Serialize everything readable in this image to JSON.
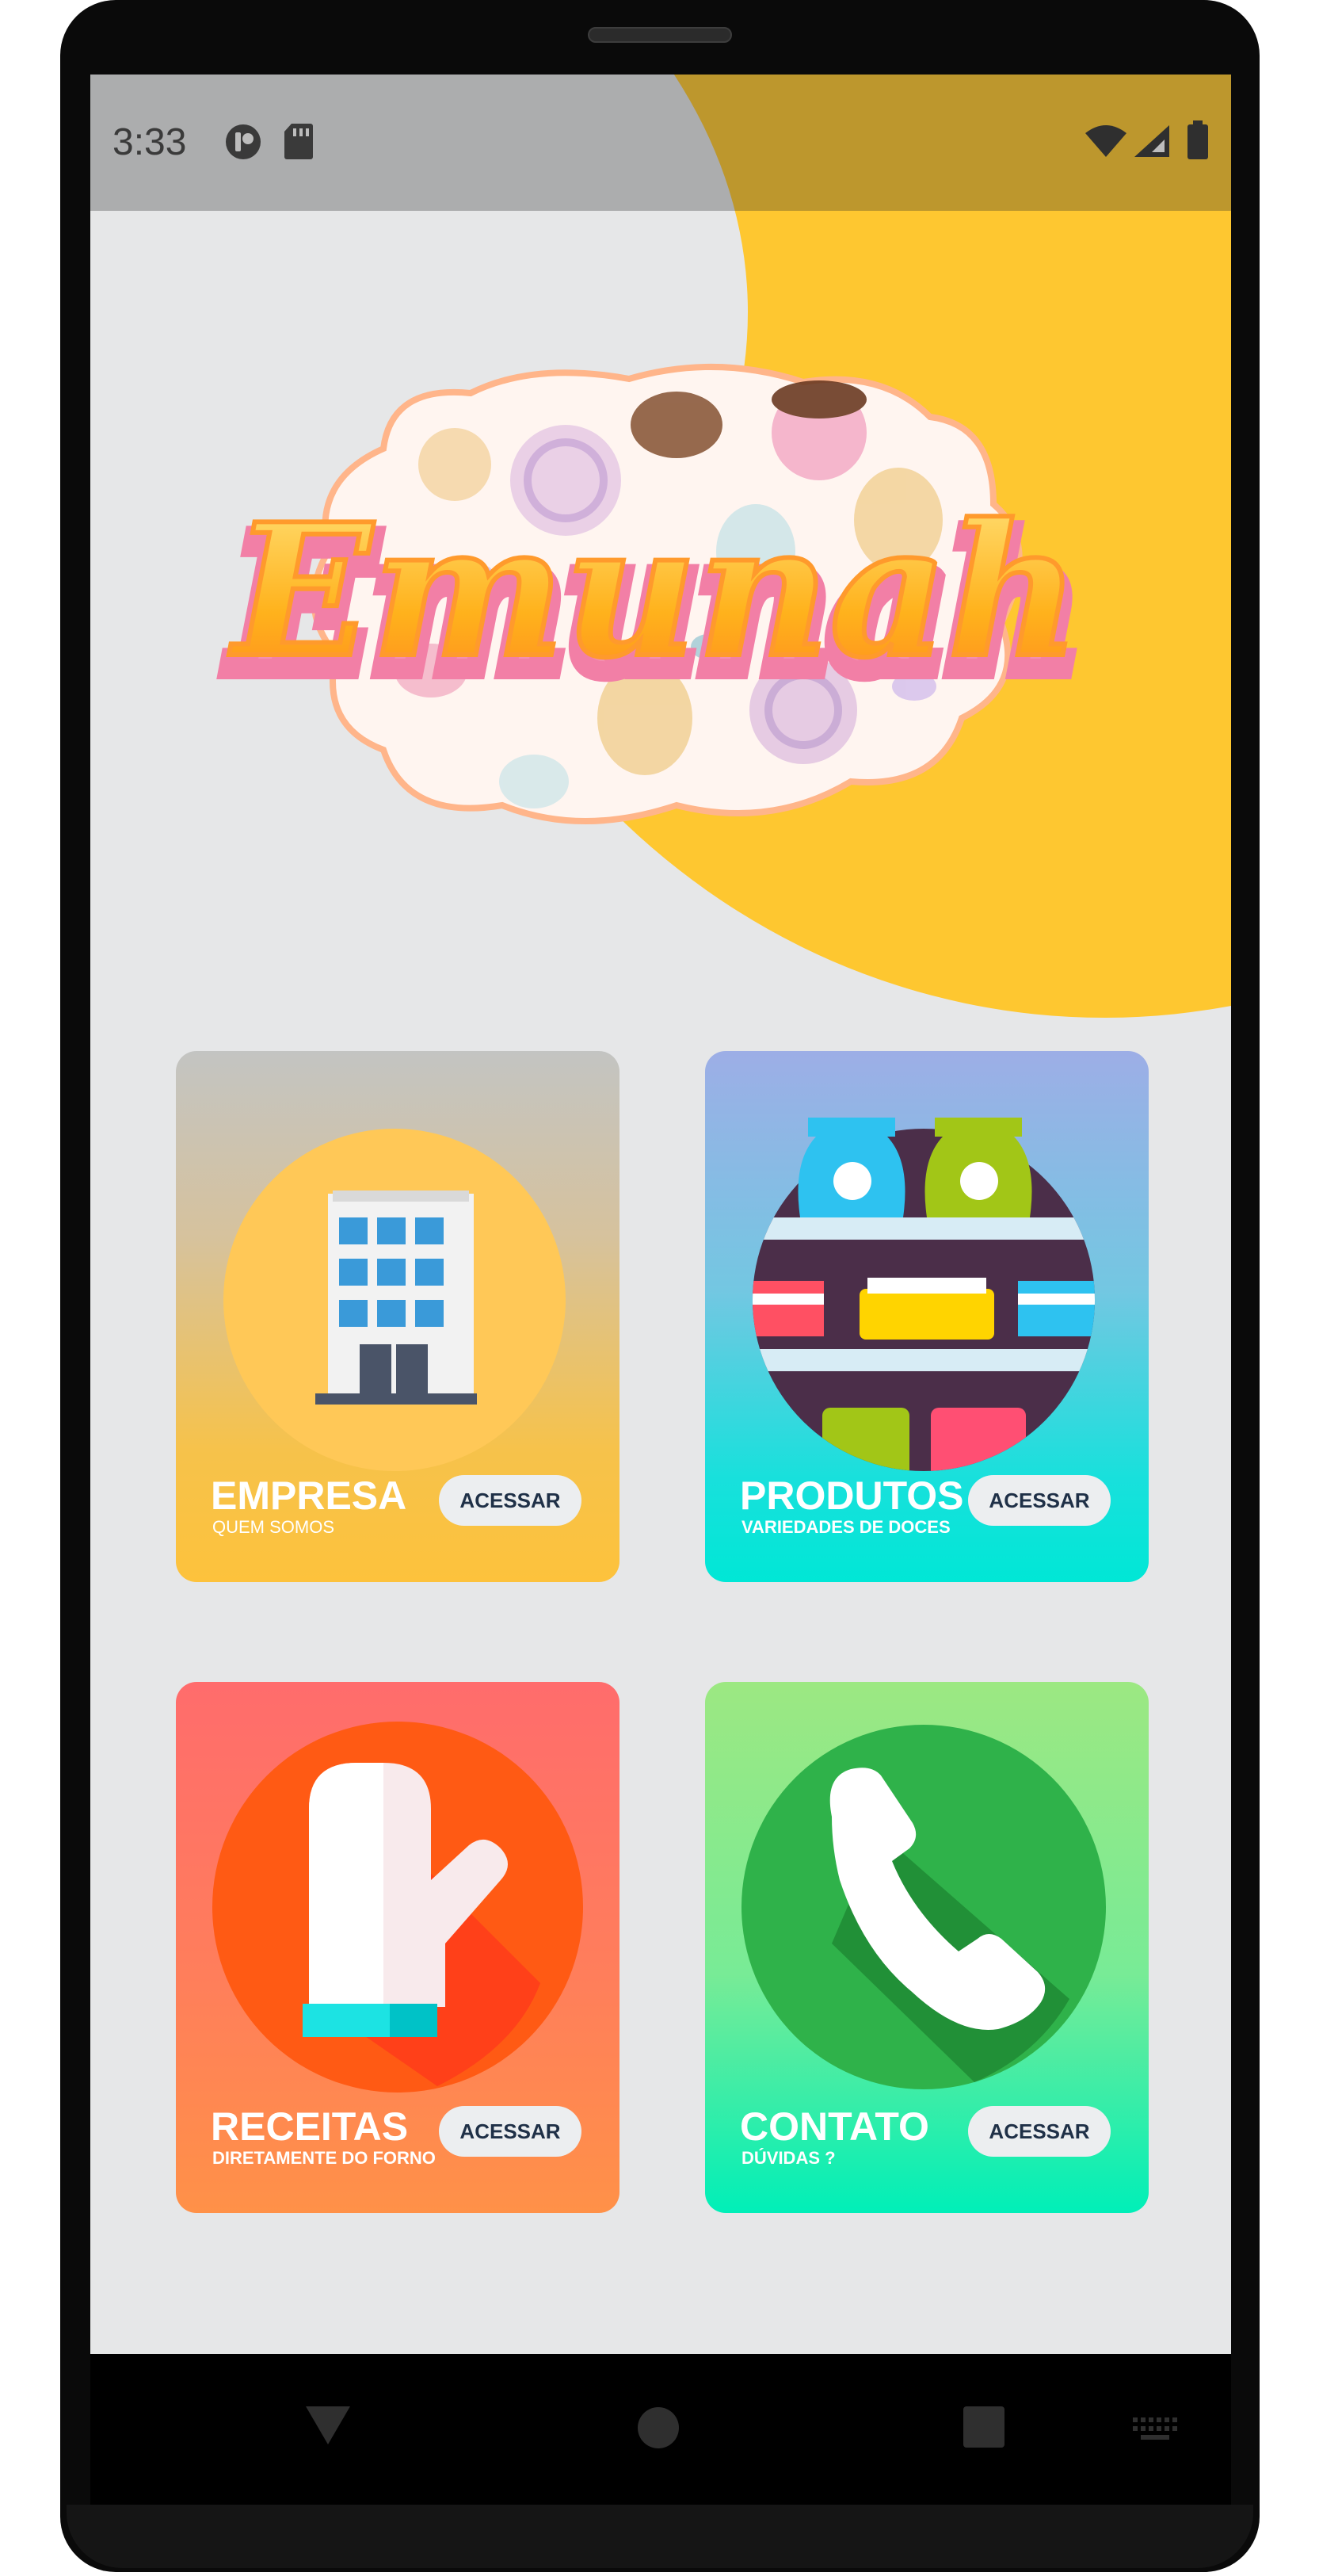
{
  "status_bar": {
    "time": "3:33",
    "left_icons": [
      "notification-app-icon",
      "sd-card-icon"
    ],
    "right_icons": [
      "wifi-icon",
      "signal-icon",
      "battery-icon"
    ]
  },
  "logo": {
    "text": "Emunah"
  },
  "cards": [
    {
      "title": "EMPRESA",
      "subtitle": "QUEM SOMOS",
      "button": "ACESSAR",
      "icon": "building-icon"
    },
    {
      "title": "PRODUTOS",
      "subtitle": "VARIEDADES DE DOCES",
      "button": "ACESSAR",
      "icon": "shelf-icon"
    },
    {
      "title": "RECEITAS",
      "subtitle": "DIRETAMENTE DO FORNO",
      "button": "ACESSAR",
      "icon": "oven-mitt-icon"
    },
    {
      "title": "CONTATO",
      "subtitle": "DÚVIDAS ?",
      "button": "ACESSAR",
      "icon": "phone-icon"
    }
  ],
  "nav_bar": {
    "buttons": [
      "back-icon",
      "home-icon",
      "recents-icon",
      "keyboard-icon"
    ]
  },
  "colors": {
    "accent_yellow": "#fec730",
    "background": "#e6e7e8",
    "button_text": "#1f3047"
  }
}
